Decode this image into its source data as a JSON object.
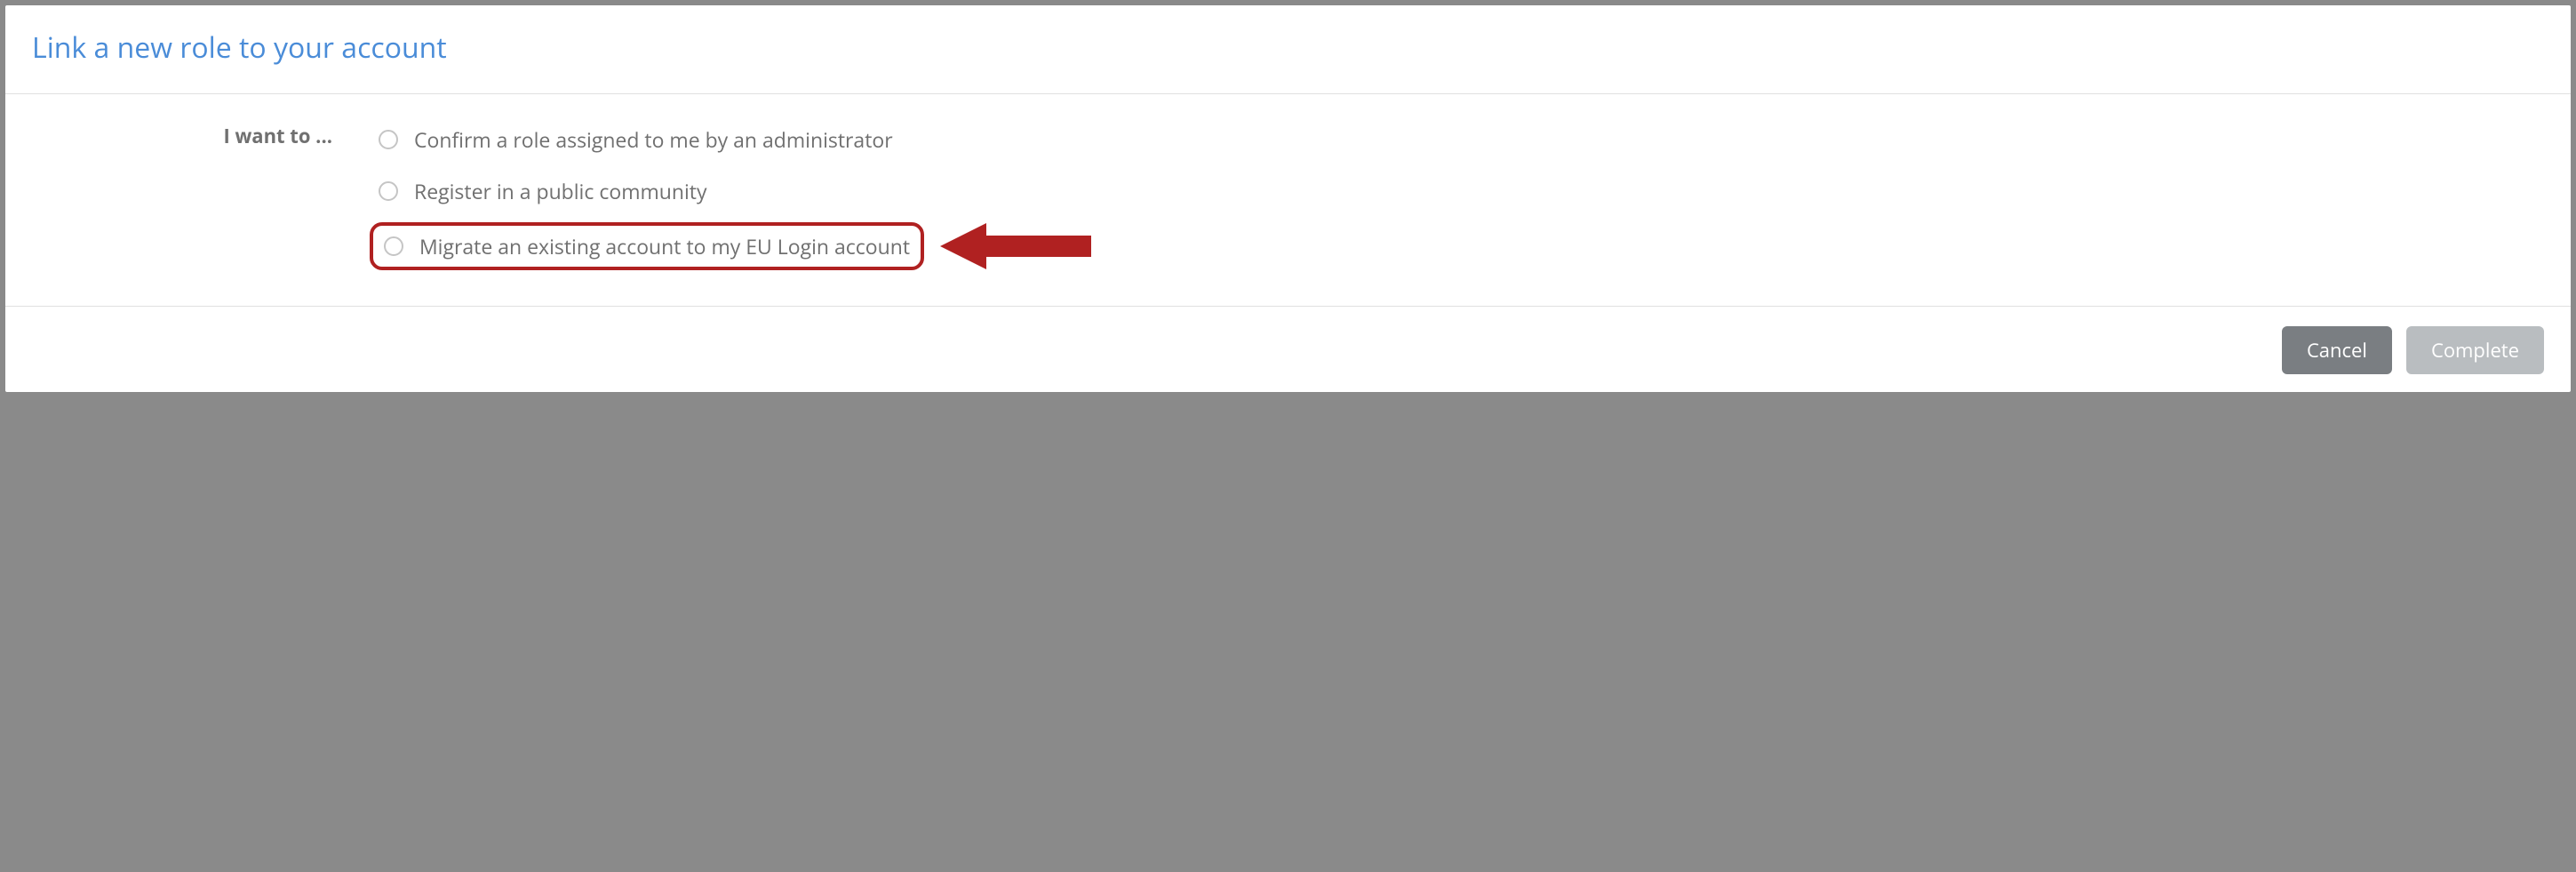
{
  "modal": {
    "title": "Link a new role to your account",
    "form_label": "I want to ...",
    "options": {
      "confirm": "Confirm a role assigned to me by an administrator",
      "register": "Register in a public community",
      "migrate": "Migrate an existing account to my EU Login account"
    },
    "buttons": {
      "cancel": "Cancel",
      "complete": "Complete"
    }
  },
  "annotation": {
    "highlight_color": "#b02121"
  }
}
